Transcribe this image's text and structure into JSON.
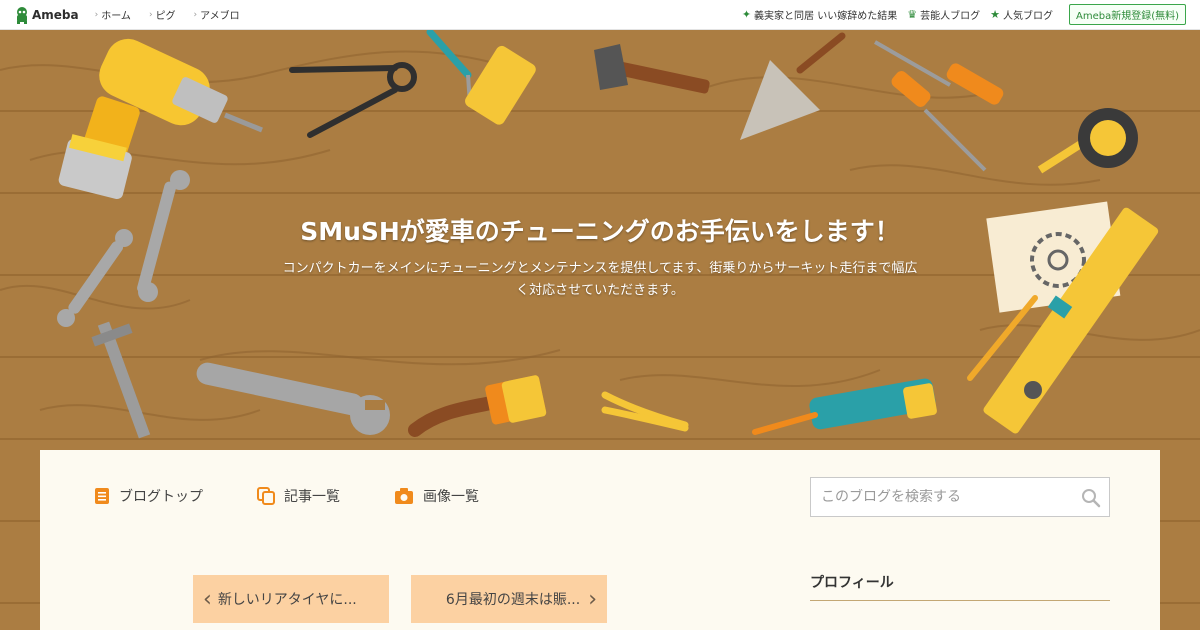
{
  "topbar": {
    "logo_text": "Ameba",
    "left_nav": [
      "ホーム",
      "ピグ",
      "アメブロ"
    ],
    "right_nav": [
      {
        "label": "義実家と同居 いい嫁辞めた結果",
        "icon": "sparkle-icon"
      },
      {
        "label": "芸能人ブログ",
        "icon": "crown-icon"
      },
      {
        "label": "人気ブログ",
        "icon": "star-icon"
      }
    ],
    "signup_label": "Ameba新規登録(無料)"
  },
  "hero": {
    "title": "SMuSHが愛車のチューニングのお手伝いをします！",
    "description": "コンパクトカーをメインにチューニングとメンテナンスを提供してます、街乗りからサーキット走行まで幅広く対応させていただきます。"
  },
  "global_nav": [
    {
      "label": "ブログトップ",
      "icon": "document-icon"
    },
    {
      "label": "記事一覧",
      "icon": "copy-icon"
    },
    {
      "label": "画像一覧",
      "icon": "camera-icon"
    }
  ],
  "search": {
    "placeholder": "このブログを検索する"
  },
  "pager": {
    "prev_label": "新しいリアタイヤに...",
    "next_label": "6月最初の週末は賑..."
  },
  "sidebar": {
    "profile_heading": "プロフィール"
  },
  "colors": {
    "brand_green": "#2e8b3a",
    "accent_orange": "#f08a1c",
    "pager_bg": "#fcd1a2",
    "wood": "#ab7d42",
    "panel_bg": "#fdfaf1"
  }
}
